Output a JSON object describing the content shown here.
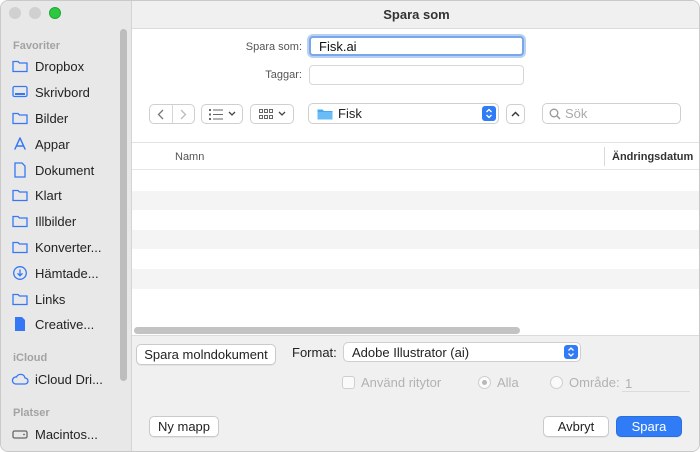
{
  "window": {
    "title": "Spara som"
  },
  "sidebar": {
    "sections": {
      "favorites": "Favoriter",
      "icloud": "iCloud",
      "places": "Platser"
    },
    "favorites": [
      {
        "label": "Dropbox",
        "icon": "folder-icon"
      },
      {
        "label": "Skrivbord",
        "icon": "desktop-icon"
      },
      {
        "label": "Bilder",
        "icon": "folder-icon"
      },
      {
        "label": "Appar",
        "icon": "apps-icon"
      },
      {
        "label": "Dokument",
        "icon": "document-icon"
      },
      {
        "label": "Klart",
        "icon": "folder-icon"
      },
      {
        "label": "Illbilder",
        "icon": "folder-icon"
      },
      {
        "label": "Konverter...",
        "icon": "folder-icon"
      },
      {
        "label": "Hämtade...",
        "icon": "download-icon"
      },
      {
        "label": "Links",
        "icon": "folder-icon"
      },
      {
        "label": "Creative...",
        "icon": "file-icon"
      }
    ],
    "icloud": [
      {
        "label": "iCloud Dri...",
        "icon": "cloud-icon"
      }
    ],
    "places": [
      {
        "label": "Macintos...",
        "icon": "disk-icon"
      }
    ]
  },
  "form": {
    "save_as_label": "Spara som:",
    "save_as_value": "Fisk.ai",
    "tags_label": "Taggar:",
    "tags_value": ""
  },
  "toolbar": {
    "location": "Fisk",
    "search_placeholder": "Sök"
  },
  "filelist": {
    "col_name": "Namn",
    "col_date": "Ändringsdatum",
    "rows": 7
  },
  "options": {
    "cloud_doc_button": "Spara molndokument",
    "format_label": "Format:",
    "format_value": "Adobe Illustrator (ai)",
    "use_artboards": "Använd ritytor",
    "all": "Alla",
    "range": "Område:",
    "range_value": "1"
  },
  "footer": {
    "new_folder": "Ny mapp",
    "cancel": "Avbryt",
    "save": "Spara"
  },
  "colors": {
    "accent": "#2f7cf6",
    "sidebar_icon": "#3478f6"
  }
}
